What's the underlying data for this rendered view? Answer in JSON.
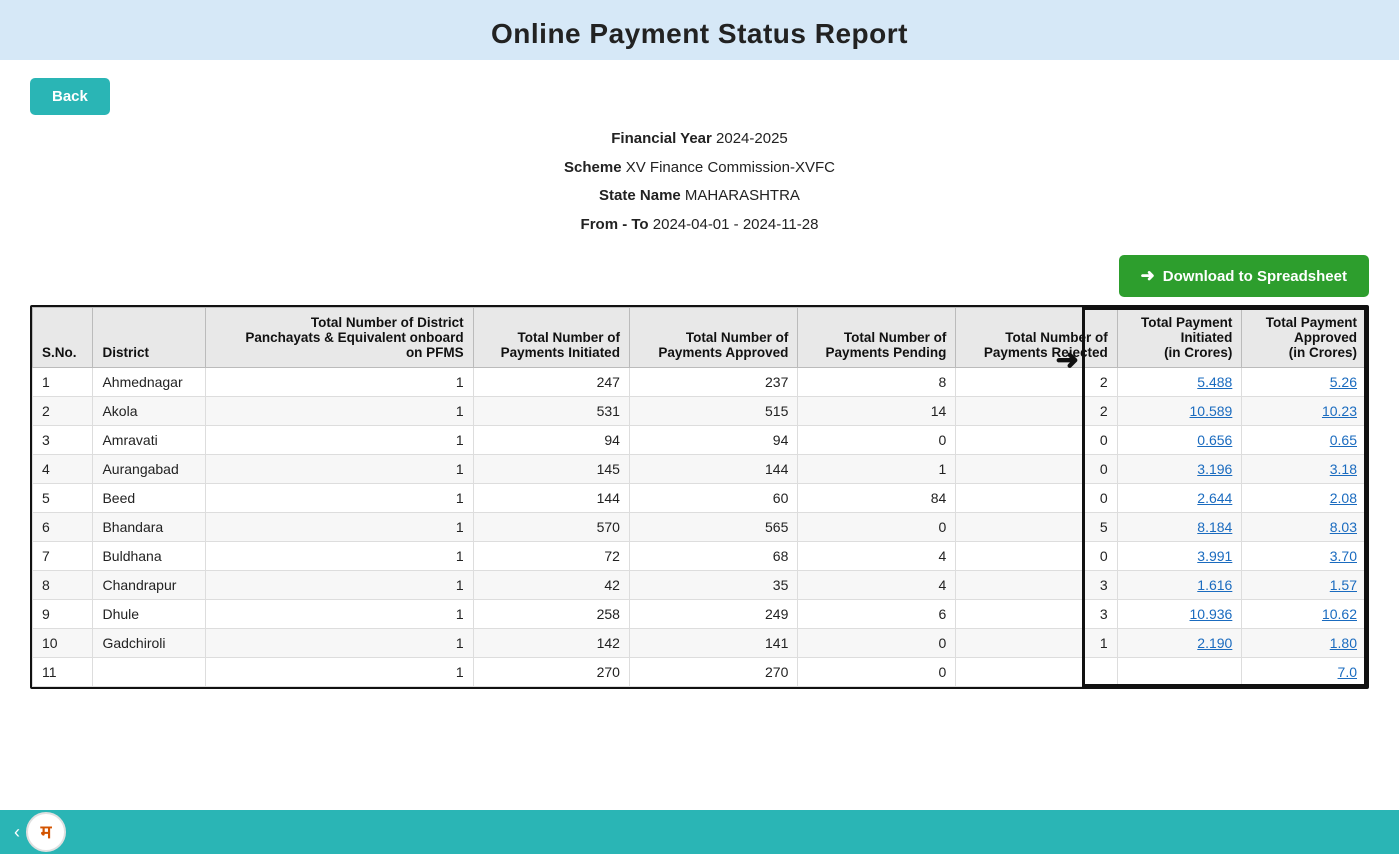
{
  "page": {
    "title": "Online Payment Status Report",
    "back_label": "Back",
    "financial_year_label": "Financial Year",
    "financial_year_value": "2024-2025",
    "scheme_label": "Scheme",
    "scheme_value": "XV Finance Commission-XVFC",
    "state_label": "State Name",
    "state_value": "MAHARASHTRA",
    "from_to_label": "From - To",
    "from_to_value": "2024-04-01 - 2024-11-28",
    "download_btn": "Download to Spreadsheet"
  },
  "table": {
    "headers": [
      "S.No.",
      "District",
      "Total Number of District Panchayats & Equivalent onboard on PFMS",
      "Total Number of Payments Initiated",
      "Total Number of Payments Approved",
      "Total Number of Payments Pending",
      "Total Number of Payments Rejected",
      "Total Payment Initiated (in Crores)",
      "Total Payment Approved (in Crores)"
    ],
    "rows": [
      {
        "sno": "1",
        "district": "Ahmednagar",
        "onboard": "1",
        "initiated": "247",
        "approved": "237",
        "pending": "8",
        "rejected": "2",
        "amt_initiated": "5.488",
        "amt_approved": "5.26"
      },
      {
        "sno": "2",
        "district": "Akola",
        "onboard": "1",
        "initiated": "531",
        "approved": "515",
        "pending": "14",
        "rejected": "2",
        "amt_initiated": "10.589",
        "amt_approved": "10.23"
      },
      {
        "sno": "3",
        "district": "Amravati",
        "onboard": "1",
        "initiated": "94",
        "approved": "94",
        "pending": "0",
        "rejected": "0",
        "amt_initiated": "0.656",
        "amt_approved": "0.65"
      },
      {
        "sno": "4",
        "district": "Aurangabad",
        "onboard": "1",
        "initiated": "145",
        "approved": "144",
        "pending": "1",
        "rejected": "0",
        "amt_initiated": "3.196",
        "amt_approved": "3.18"
      },
      {
        "sno": "5",
        "district": "Beed",
        "onboard": "1",
        "initiated": "144",
        "approved": "60",
        "pending": "84",
        "rejected": "0",
        "amt_initiated": "2.644",
        "amt_approved": "2.08"
      },
      {
        "sno": "6",
        "district": "Bhandara",
        "onboard": "1",
        "initiated": "570",
        "approved": "565",
        "pending": "0",
        "rejected": "5",
        "amt_initiated": "8.184",
        "amt_approved": "8.03"
      },
      {
        "sno": "7",
        "district": "Buldhana",
        "onboard": "1",
        "initiated": "72",
        "approved": "68",
        "pending": "4",
        "rejected": "0",
        "amt_initiated": "3.991",
        "amt_approved": "3.70"
      },
      {
        "sno": "8",
        "district": "Chandrapur",
        "onboard": "1",
        "initiated": "42",
        "approved": "35",
        "pending": "4",
        "rejected": "3",
        "amt_initiated": "1.616",
        "amt_approved": "1.57"
      },
      {
        "sno": "9",
        "district": "Dhule",
        "onboard": "1",
        "initiated": "258",
        "approved": "249",
        "pending": "6",
        "rejected": "3",
        "amt_initiated": "10.936",
        "amt_approved": "10.62"
      },
      {
        "sno": "10",
        "district": "Gadchiroli",
        "onboard": "1",
        "initiated": "142",
        "approved": "141",
        "pending": "0",
        "rejected": "1",
        "amt_initiated": "2.190",
        "amt_approved": "1.80"
      },
      {
        "sno": "11",
        "district": "",
        "onboard": "1",
        "initiated": "270",
        "approved": "270",
        "pending": "0",
        "rejected": "",
        "amt_initiated": "",
        "amt_approved": "7.0"
      }
    ]
  }
}
